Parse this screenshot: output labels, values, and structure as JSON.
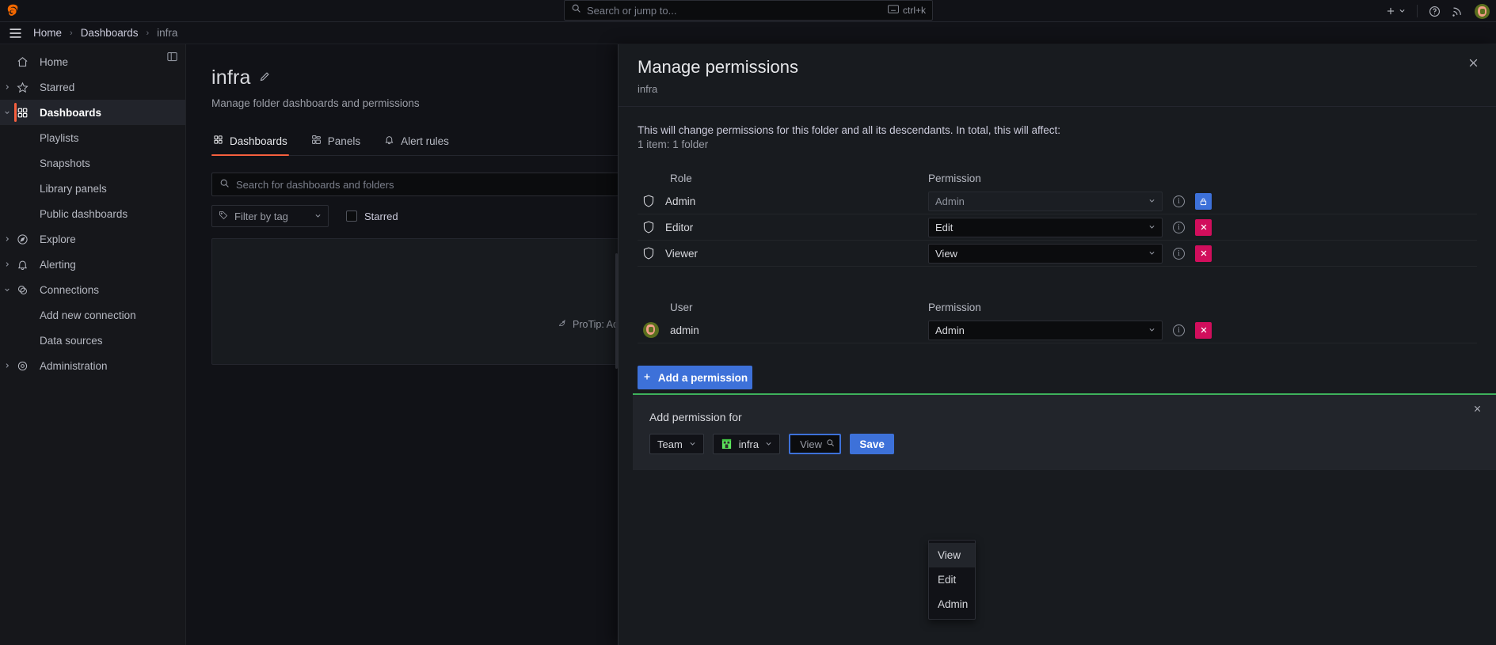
{
  "topbar": {
    "logo_icon": "grafana-logo-icon",
    "search": {
      "placeholder": "Search or jump to...",
      "shortcut": "ctrl+k",
      "icon": "search-icon",
      "kbd_icon": "keyboard-icon"
    },
    "add_icon": "plus-icon",
    "add_chevron_icon": "chevron-down-icon",
    "help_icon": "help-circle-icon",
    "news_icon": "rss-icon",
    "profile_icon": "user-avatar"
  },
  "breadcrumb": {
    "menu_icon": "hamburger-menu-icon",
    "items": [
      {
        "label": "Home"
      },
      {
        "label": "Dashboards"
      },
      {
        "label": "infra"
      }
    ],
    "separator": "›"
  },
  "sidebar": {
    "dock_icon": "dock-menu-icon",
    "items": [
      {
        "label": "Home",
        "icon": "home-icon",
        "level": 0,
        "expandable": false,
        "active": false
      },
      {
        "label": "Starred",
        "icon": "star-icon",
        "level": 0,
        "expandable": true,
        "active": false
      },
      {
        "label": "Dashboards",
        "icon": "dashboards-grid-icon",
        "level": 0,
        "expandable": true,
        "expanded": true,
        "active": true
      },
      {
        "label": "Playlists",
        "icon": "",
        "level": 1,
        "expandable": false,
        "active": false
      },
      {
        "label": "Snapshots",
        "icon": "",
        "level": 1,
        "expandable": false,
        "active": false
      },
      {
        "label": "Library panels",
        "icon": "",
        "level": 1,
        "expandable": false,
        "active": false
      },
      {
        "label": "Public dashboards",
        "icon": "",
        "level": 1,
        "expandable": false,
        "active": false
      },
      {
        "label": "Explore",
        "icon": "compass-icon",
        "level": 0,
        "expandable": true,
        "active": false
      },
      {
        "label": "Alerting",
        "icon": "bell-icon",
        "level": 0,
        "expandable": true,
        "active": false
      },
      {
        "label": "Connections",
        "icon": "connections-icon",
        "level": 0,
        "expandable": true,
        "expanded": true,
        "active": false
      },
      {
        "label": "Add new connection",
        "icon": "",
        "level": 1,
        "expandable": false,
        "active": false
      },
      {
        "label": "Data sources",
        "icon": "",
        "level": 1,
        "expandable": false,
        "active": false
      },
      {
        "label": "Administration",
        "icon": "gear-icon",
        "level": 0,
        "expandable": true,
        "active": false
      }
    ]
  },
  "page": {
    "title": "infra",
    "edit_icon": "pencil-icon",
    "subtitle": "Manage folder dashboards and permissions",
    "tabs": [
      {
        "label": "Dashboards",
        "icon": "dashboards-grid-icon",
        "active": true
      },
      {
        "label": "Panels",
        "icon": "panels-icon",
        "active": false
      },
      {
        "label": "Alert rules",
        "icon": "bell-icon",
        "active": false
      }
    ],
    "search": {
      "placeholder": "Search for dashboards and folders",
      "icon": "search-icon"
    },
    "filter_tag": {
      "label": "Filter by tag",
      "icon": "tag-icon",
      "chevron_icon": "chevron-down-icon"
    },
    "starred": {
      "label": "Starred",
      "checked": false
    },
    "protip": {
      "icon": "rocket-icon",
      "text": "ProTip: Add"
    }
  },
  "drawer": {
    "title": "Manage permissions",
    "subtitle": "infra",
    "close_icon": "close-icon",
    "warning_line1": "This will change permissions for this folder and all its descendants. In total, this will affect:",
    "warning_line2": "1 item: 1 folder",
    "role_table": {
      "columns": [
        "Role",
        "Permission"
      ],
      "rows": [
        {
          "name": "Admin",
          "icon": "shield-icon",
          "permission": "Admin",
          "locked": true,
          "action_icon": "lock-icon",
          "info_icon": "info-circle-icon"
        },
        {
          "name": "Editor",
          "icon": "shield-icon",
          "permission": "Edit",
          "locked": false,
          "action_icon": "remove-x-icon",
          "info_icon": "info-circle-icon"
        },
        {
          "name": "Viewer",
          "icon": "shield-icon",
          "permission": "View",
          "locked": false,
          "action_icon": "remove-x-icon",
          "info_icon": "info-circle-icon"
        }
      ]
    },
    "user_table": {
      "columns": [
        "User",
        "Permission"
      ],
      "rows": [
        {
          "name": "admin",
          "icon": "user-avatar",
          "permission": "Admin",
          "locked": false,
          "action_icon": "remove-x-icon",
          "info_icon": "info-circle-icon"
        }
      ]
    },
    "add_permission_button": {
      "label": "Add a permission",
      "icon": "plus-icon"
    },
    "add_box": {
      "title": "Add permission for",
      "close_icon": "close-icon",
      "target_type": {
        "value": "Team",
        "chevron_icon": "chevron-down-icon"
      },
      "target": {
        "value": "infra",
        "icon": "team-icon",
        "chevron_icon": "chevron-down-icon"
      },
      "permission_input": {
        "placeholder": "View",
        "value": "",
        "search_icon": "search-icon"
      },
      "save_label": "Save",
      "permission_options": [
        "View",
        "Edit",
        "Admin"
      ],
      "highlighted_option": "View",
      "accent_color": "#3eb15b"
    }
  },
  "colors": {
    "brand_orange": "#f55f3e",
    "primary_blue": "#3d71d9",
    "danger_pink": "#d10e5c",
    "success_green": "#3eb15b",
    "bg": "#111217",
    "panel_bg": "#181b1f"
  }
}
